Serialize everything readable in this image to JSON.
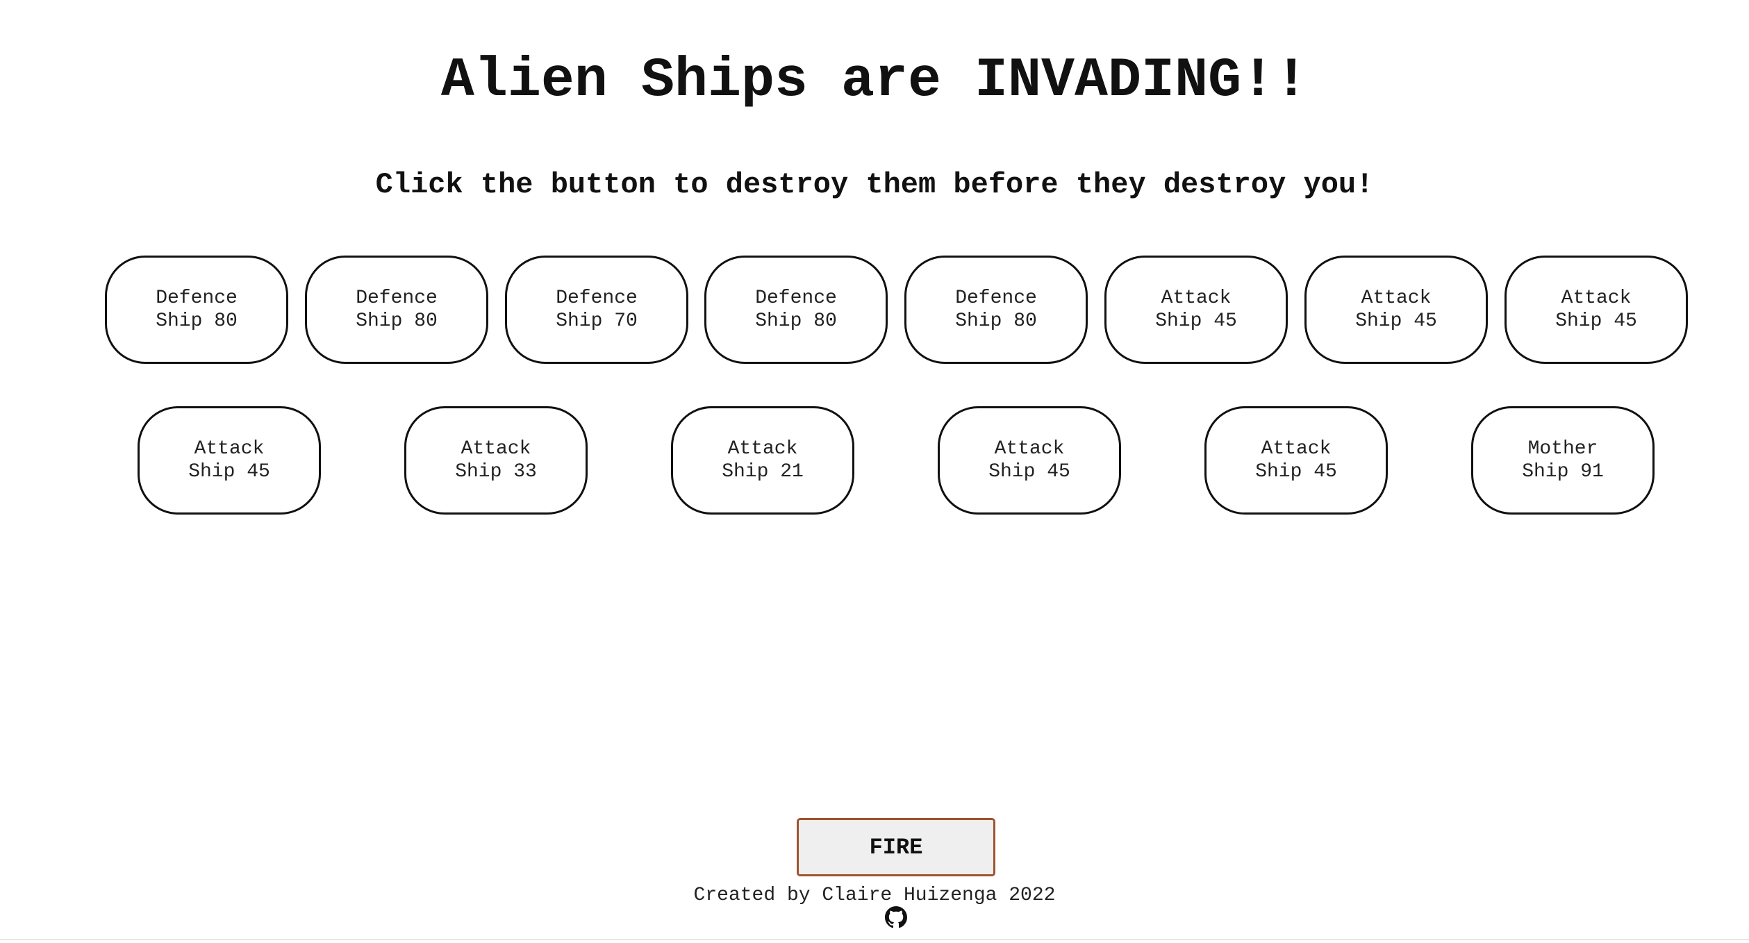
{
  "page": {
    "title": "Alien Ships are INVADING!!",
    "subtitle": "Click the button to destroy them before they destroy you!"
  },
  "ships": {
    "row1": [
      {
        "type": "Defence",
        "label": "Ship 80"
      },
      {
        "type": "Defence",
        "label": "Ship 80"
      },
      {
        "type": "Defence",
        "label": "Ship 70"
      },
      {
        "type": "Defence",
        "label": "Ship 80"
      },
      {
        "type": "Defence",
        "label": "Ship 80"
      },
      {
        "type": "Attack",
        "label": "Ship 45"
      },
      {
        "type": "Attack",
        "label": "Ship 45"
      },
      {
        "type": "Attack",
        "label": "Ship 45"
      }
    ],
    "row2": [
      {
        "type": "Attack",
        "label": "Ship 45"
      },
      {
        "type": "Attack",
        "label": "Ship 33"
      },
      {
        "type": "Attack",
        "label": "Ship 21"
      },
      {
        "type": "Attack",
        "label": "Ship 45"
      },
      {
        "type": "Attack",
        "label": "Ship 45"
      },
      {
        "type": "Mother",
        "label": "Ship 91"
      }
    ]
  },
  "controls": {
    "fire_label": "FIRE"
  },
  "footer": {
    "credit": "Created by Claire Huizenga 2022",
    "github_icon": "github-icon"
  },
  "colors": {
    "text": "#111111",
    "ship_border": "#111111",
    "fire_border": "#a0522d",
    "fire_background": "#efefef"
  }
}
